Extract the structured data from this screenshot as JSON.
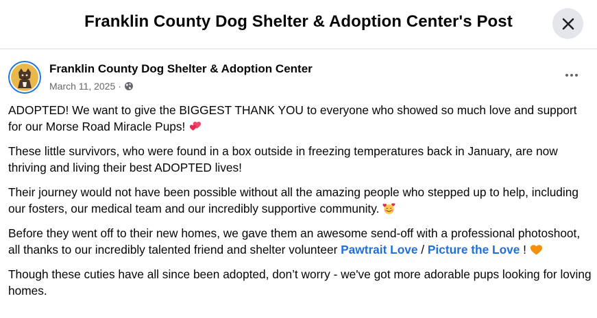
{
  "header": {
    "title": "Franklin County Dog Shelter & Adoption Center's Post"
  },
  "post": {
    "author": "Franklin County Dog Shelter & Adoption Center",
    "date": "March 11, 2025",
    "separator": "·",
    "privacy_icon": "globe-icon",
    "avatar_icon": "dog-avatar",
    "paragraphs": {
      "p1": "ADOPTED! We want to give the BIGGEST THANK YOU to everyone who showed so much love and support for our Morse Road Miracle Pups! ",
      "p2": "These little survivors, who were found in a box outside in freezing temperatures back in January, are now thriving and living their best ADOPTED lives!",
      "p3": "Their journey would not have been possible without all the amazing people who stepped up to help, including our fosters, our medical team and our incredibly supportive community. ",
      "p4_pre": "Before they went off to their new homes, we gave them an awesome send-off with a professional photoshoot, all thanks to our incredibly talented friend and shelter volunteer ",
      "p4_link1": "Pawtrait Love",
      "p4_sep": " / ",
      "p4_link2": "Picture the Love",
      "p4_post": " ! ",
      "p5": "Though these cuties have all since been adopted, don’t worry - we've got more adorable pups looking for loving homes."
    },
    "emojis": {
      "p1": "two-hearts-emoji",
      "p3": "smiling-face-with-hearts-emoji",
      "p4": "orange-heart-emoji"
    }
  },
  "colors": {
    "link": "#216fdb",
    "meta": "#65676b",
    "close_bg": "#e4e6eb",
    "avatar_ring": "#1b74e4",
    "avatar_bg": "#e8b84a"
  }
}
